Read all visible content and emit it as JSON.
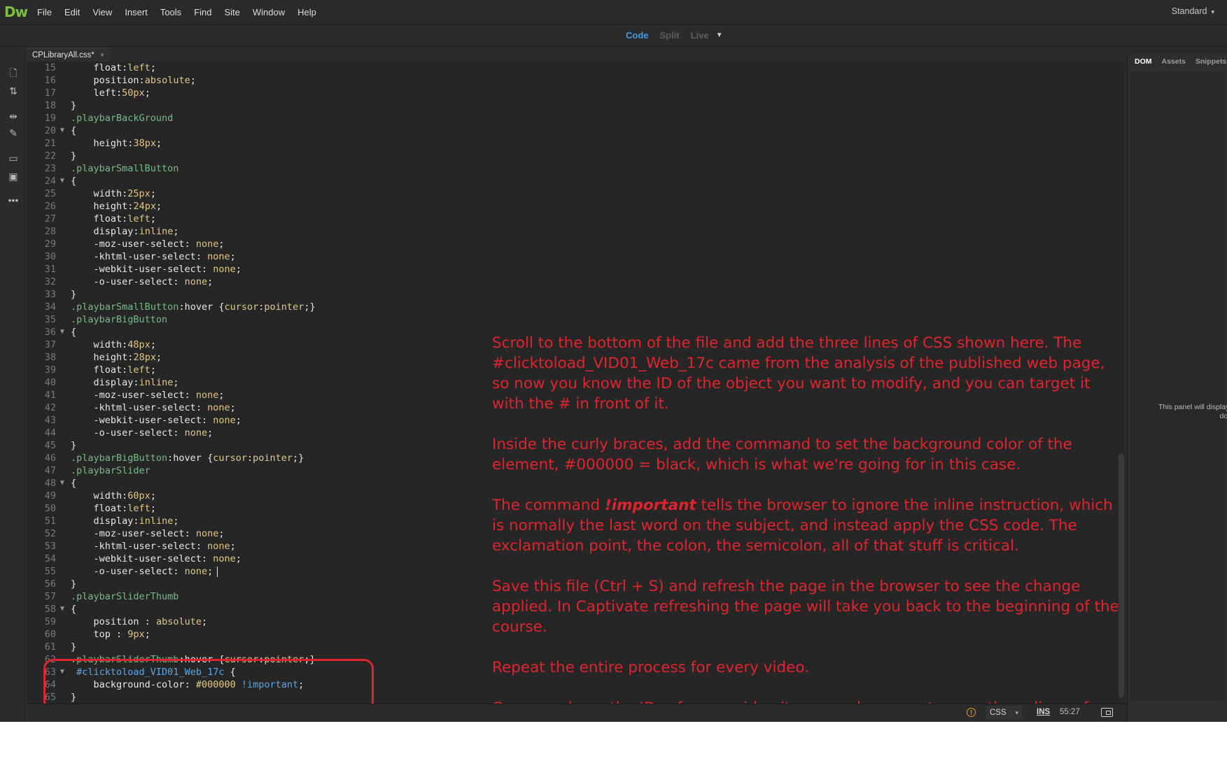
{
  "app": {
    "logo": "Dw",
    "workspace": "Standard"
  },
  "menu": [
    "File",
    "Edit",
    "View",
    "Insert",
    "Tools",
    "Find",
    "Site",
    "Window",
    "Help"
  ],
  "view_modes": {
    "code": "Code",
    "split": "Split",
    "live": "Live"
  },
  "document_tab": {
    "name": "CPLibraryAll.css*",
    "close": "×"
  },
  "right_panel": {
    "tabs": [
      "DOM",
      "Assets",
      "Snippets"
    ],
    "message_line1": "This panel will display the",
    "message_line2": "docum"
  },
  "code_lines": [
    {
      "n": "15",
      "text": "    float:left;"
    },
    {
      "n": "16",
      "text": "    position:absolute;"
    },
    {
      "n": "17",
      "text": "    left:50px;"
    },
    {
      "n": "18",
      "text": "}"
    },
    {
      "n": "19",
      "text": ".playbarBackGround"
    },
    {
      "n": "20",
      "text": "{"
    },
    {
      "n": "21",
      "text": "    height:38px;"
    },
    {
      "n": "22",
      "text": "}"
    },
    {
      "n": "23",
      "text": ".playbarSmallButton"
    },
    {
      "n": "24",
      "text": "{"
    },
    {
      "n": "25",
      "text": "    width:25px;"
    },
    {
      "n": "26",
      "text": "    height:24px;"
    },
    {
      "n": "27",
      "text": "    float:left;"
    },
    {
      "n": "28",
      "text": "    display:inline;"
    },
    {
      "n": "29",
      "text": "    -moz-user-select: none;"
    },
    {
      "n": "30",
      "text": "    -khtml-user-select: none;"
    },
    {
      "n": "31",
      "text": "    -webkit-user-select: none;"
    },
    {
      "n": "32",
      "text": "    -o-user-select: none;"
    },
    {
      "n": "33",
      "text": "}"
    },
    {
      "n": "34",
      "text": ".playbarSmallButton:hover {cursor:pointer;}"
    },
    {
      "n": "35",
      "text": ".playbarBigButton"
    },
    {
      "n": "36",
      "text": "{"
    },
    {
      "n": "37",
      "text": "    width:48px;"
    },
    {
      "n": "38",
      "text": "    height:28px;"
    },
    {
      "n": "39",
      "text": "    float:left;"
    },
    {
      "n": "40",
      "text": "    display:inline;"
    },
    {
      "n": "41",
      "text": "    -moz-user-select: none;"
    },
    {
      "n": "42",
      "text": "    -khtml-user-select: none;"
    },
    {
      "n": "43",
      "text": "    -webkit-user-select: none;"
    },
    {
      "n": "44",
      "text": "    -o-user-select: none;"
    },
    {
      "n": "45",
      "text": "}"
    },
    {
      "n": "46",
      "text": ".playbarBigButton:hover {cursor:pointer;}"
    },
    {
      "n": "47",
      "text": ".playbarSlider"
    },
    {
      "n": "48",
      "text": "{"
    },
    {
      "n": "49",
      "text": "    width:60px;"
    },
    {
      "n": "50",
      "text": "    float:left;"
    },
    {
      "n": "51",
      "text": "    display:inline;"
    },
    {
      "n": "52",
      "text": "    -moz-user-select: none;"
    },
    {
      "n": "53",
      "text": "    -khtml-user-select: none;"
    },
    {
      "n": "54",
      "text": "    -webkit-user-select: none;"
    },
    {
      "n": "55",
      "text": "    -o-user-select: none;"
    },
    {
      "n": "56",
      "text": "}"
    },
    {
      "n": "57",
      "text": ".playbarSliderThumb"
    },
    {
      "n": "58",
      "text": "{"
    },
    {
      "n": "59",
      "text": "    position : absolute;"
    },
    {
      "n": "60",
      "text": "    top : 9px;"
    },
    {
      "n": "61",
      "text": "}"
    },
    {
      "n": "62",
      "text": ".playbarSliderThumb:hover {cursor:pointer;}"
    },
    {
      "n": "63",
      "text": " #clicktoload_VID01_Web_17c {"
    },
    {
      "n": "64",
      "text": "    background-color: #000000 !important;"
    },
    {
      "n": "65",
      "text": "}"
    }
  ],
  "annotation": {
    "p1": "Scroll to the bottom of the file and add the three lines of CSS shown here. The #clicktoload_VID01_Web_17c came from the analysis of the published web page, so now you know the ID of  the object you want to modify, and you can target it with the # in front of it.",
    "p2": "Inside the curly braces, add the command to set the background color of the element, #000000 = black, which is what we're going for in this case.",
    "p3_a": "The command ",
    "p3_em": "!important",
    "p3_b": " tells the browser to ignore the inline instruction, which is normally the last word on the subject, and instead apply the CSS code. The exclamation point, the colon, the semicolon, all of that stuff is critical.",
    "p4": "Save this file (Ctrl + S) and refresh the page in the browser to see the change applied. In Captivate refreshing the page will take you back to the beginning of the course.",
    "p5": "Repeat the entire process for every video.",
    "p6": "Once you have the IDs of every video it may make sense to save these lines of CSS into a separate .txt file in Notepad so that you can copy / paste them into this CSS file again in the future if needed."
  },
  "status": {
    "warning": "!",
    "language": "CSS",
    "mode": "INS",
    "cursor_position": "55:27"
  },
  "colors": {
    "accent": "#3d9be9",
    "annotation_red": "#e0242e",
    "logo_green": "#7fbf3f"
  }
}
